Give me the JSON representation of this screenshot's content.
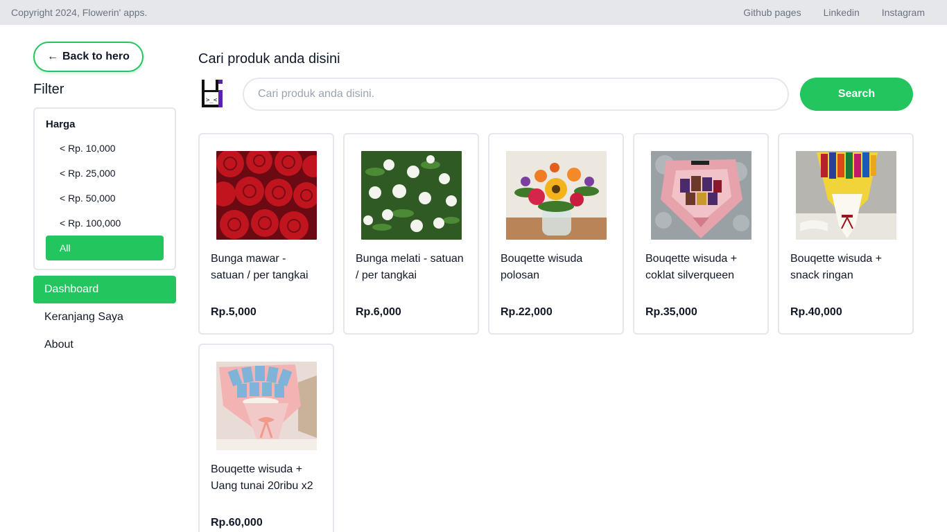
{
  "topbar": {
    "copyright": "Copyright 2024, Flowerin' apps.",
    "links": [
      "Github pages",
      "Linkedin",
      "Instagram"
    ]
  },
  "sidebar": {
    "back_label": "Back to hero",
    "filter_title": "Filter",
    "price_group_title": "Harga",
    "price_options": [
      "< Rp. 10,000",
      "< Rp. 25,000",
      "< Rp. 50,000",
      "< Rp. 100,000",
      "All"
    ],
    "selected_option": "All",
    "nav": [
      "Dashboard",
      "Keranjang Saya",
      "About"
    ],
    "active_nav": "Dashboard"
  },
  "main": {
    "title": "Cari produk anda disini",
    "search": {
      "placeholder": "Cari produk anda disini.",
      "value": "",
      "button_label": "Search"
    },
    "products": [
      {
        "name": "Bunga mawar - satuan / per tangkai",
        "price": "Rp.5,000",
        "image": "red-roses"
      },
      {
        "name": "Bunga melati - satuan / per tangkai",
        "price": "Rp.6,000",
        "image": "white-jasmine"
      },
      {
        "name": "Bouqette wisuda polosan",
        "price": "Rp.22,000",
        "image": "flower-vase"
      },
      {
        "name": "Bouqette wisuda + coklat silverqueen",
        "price": "Rp.35,000",
        "image": "chocolate-bouquet"
      },
      {
        "name": "Bouqette wisuda + snack ringan",
        "price": "Rp.40,000",
        "image": "snack-bouquet"
      },
      {
        "name": "Bouqette wisuda + Uang tunai 20ribu x2",
        "price": "Rp.60,000",
        "image": "money-bouquet"
      }
    ]
  },
  "colors": {
    "accent": "#22c55e",
    "topbar_bg": "#e5e7eb",
    "border": "#e5e7eb"
  }
}
